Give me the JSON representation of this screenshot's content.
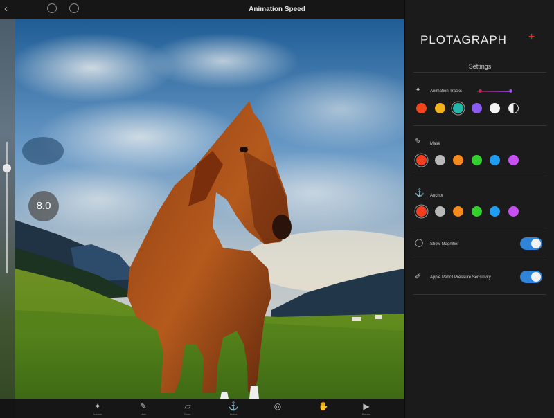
{
  "window": {
    "title": "Animation Speed"
  },
  "icons": {
    "back": "chevron-left-icon",
    "close": "close-icon"
  },
  "speed": {
    "value": "8.0",
    "slider_level": 0.8
  },
  "panel": {
    "brand": "PLOTAGRAPH",
    "brand_plus": "+",
    "settings_label": "Settings",
    "sections": [
      {
        "name": "animation-tracks",
        "label": "Animation Tracks",
        "icon": "wand-icon",
        "colors": [
          "#f0441d",
          "#f2b21c",
          "#22b7a8",
          "#8c5cf0",
          "#f5f5f5",
          "#f0f0f0"
        ],
        "selected_index": 2
      },
      {
        "name": "mask",
        "label": "Mask",
        "icon": "brush-icon",
        "colors": [
          "#f23d1f",
          "#b9b9b9",
          "#f58a1d",
          "#33d02d",
          "#1f9df0",
          "#c650f0"
        ],
        "selected_index": 0
      },
      {
        "name": "anchor",
        "label": "Anchor",
        "icon": "anchor-icon",
        "colors": [
          "#f23d1f",
          "#b9b9b9",
          "#f58a1d",
          "#33d02d",
          "#1f9df0",
          "#c650f0"
        ],
        "selected_index": 0
      }
    ],
    "toggles": [
      {
        "name": "show-magnifier",
        "label": "Show Magnifier",
        "icon": "magnifier-icon",
        "on": true
      },
      {
        "name": "apple-pencil-pressure-sensitivity",
        "label": "Apple Pencil Pressure Sensitivity",
        "icon": "pencil-icon",
        "on": true
      }
    ]
  },
  "bottom_tools": [
    {
      "name": "animate",
      "label": "Animate",
      "icon": "wand-icon"
    },
    {
      "name": "mask",
      "label": "Mask",
      "icon": "brush-icon"
    },
    {
      "name": "erase",
      "label": "Erase",
      "icon": "eraser-icon"
    },
    {
      "name": "anchor",
      "label": "Anchor",
      "icon": "anchor-icon"
    },
    {
      "name": "select",
      "label": "",
      "icon": "circle-icon"
    },
    {
      "name": "pan",
      "label": "",
      "icon": "hand-icon"
    },
    {
      "name": "preview",
      "label": "Preview",
      "icon": "play-icon"
    }
  ]
}
